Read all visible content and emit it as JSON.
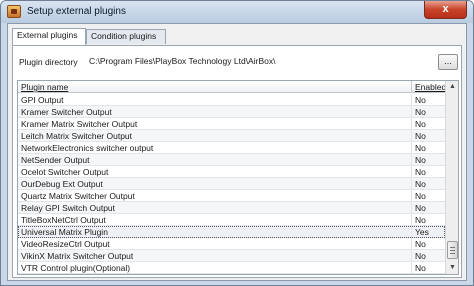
{
  "window": {
    "title": "Setup external plugins",
    "close_glyph": "x"
  },
  "tabs": [
    {
      "label": "External plugins",
      "active": true
    },
    {
      "label": "Condition plugins",
      "active": false
    }
  ],
  "plugin_directory": {
    "label": "Plugin directory",
    "value": "C:\\Program Files\\PlayBox Technology Ltd\\AirBox\\",
    "browse_label": "..."
  },
  "grid": {
    "columns": [
      "Plugin name",
      "Enabled"
    ],
    "rows": [
      {
        "name": "GPI Output",
        "enabled": "No"
      },
      {
        "name": "Kramer Switcher Output",
        "enabled": "No"
      },
      {
        "name": "Kramer Matrix Switcher Output",
        "enabled": "No"
      },
      {
        "name": "Leitch Matrix Switcher Output",
        "enabled": "No"
      },
      {
        "name": "NetworkElectronics switcher output",
        "enabled": "No"
      },
      {
        "name": "NetSender Output",
        "enabled": "No"
      },
      {
        "name": "Ocelot Switcher Output",
        "enabled": "No"
      },
      {
        "name": "OurDebug Ext Output",
        "enabled": "No"
      },
      {
        "name": "Quartz Matrix Switcher Output",
        "enabled": "No"
      },
      {
        "name": "Relay GPI Switch Output",
        "enabled": "No"
      },
      {
        "name": "TitleBoxNetCtrl Output",
        "enabled": "No"
      },
      {
        "name": "Universal Matrix Plugin",
        "enabled": "Yes"
      },
      {
        "name": "VideoResizeCtrl Output",
        "enabled": "No"
      },
      {
        "name": "VikinX Matrix Switcher Output",
        "enabled": "No"
      },
      {
        "name": "VTR Control plugin(Optional)",
        "enabled": "No"
      }
    ],
    "selected_row": "Universal Matrix Plugin",
    "scrollbar": {
      "up_glyph": "▲",
      "down_glyph": "▼"
    }
  },
  "colors": {
    "window_frame": "#c9d7e8",
    "close_button": "#c8432a",
    "panel_background": "#ffffff"
  }
}
